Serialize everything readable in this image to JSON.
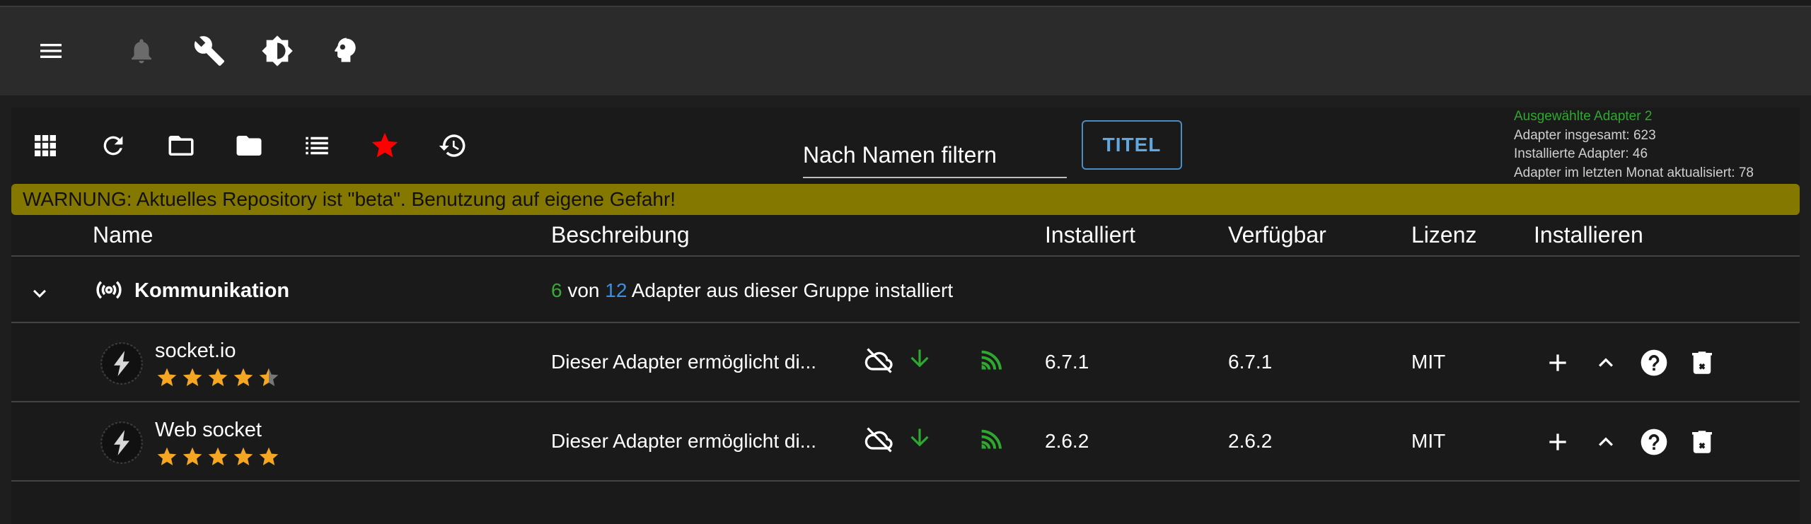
{
  "appbar": {
    "icons": [
      "menu-icon",
      "bell-icon",
      "wrench-icon",
      "brightness-icon",
      "expert-mode-icon"
    ]
  },
  "toolbar": {
    "icons": [
      "grid-view-icon",
      "refresh-icon",
      "folder-outline-icon",
      "folder-icon",
      "list-icon",
      "star-icon",
      "update-history-icon"
    ],
    "filter_placeholder": "Nach Namen filtern",
    "titel_label": "TITEL"
  },
  "stats": {
    "selected": "Ausgewählte Adapter 2",
    "total": "Adapter insgesamt: 623",
    "installed": "Installierte Adapter: 46",
    "updated": "Adapter im letzten Monat aktualisiert: 78"
  },
  "warning": "WARNUNG: Aktuelles Repository ist \"beta\". Benutzung auf eigene Gefahr!",
  "table": {
    "headers": {
      "name": "Name",
      "description": "Beschreibung",
      "installed": "Installiert",
      "available": "Verfügbar",
      "license": "Lizenz",
      "install": "Installieren"
    }
  },
  "group": {
    "name": "Kommunikation",
    "installed_count": "6",
    "von": "von",
    "total_count": "12",
    "suffix": "Adapter aus dieser Gruppe installiert"
  },
  "adapters": [
    {
      "name": "socket.io",
      "rating": 4.5,
      "description": "Dieser Adapter ermöglicht di...",
      "installed": "6.7.1",
      "available": "6.7.1",
      "license": "MIT"
    },
    {
      "name": "Web socket",
      "rating": 5,
      "description": "Dieser Adapter ermöglicht di...",
      "installed": "2.6.2",
      "available": "2.6.2",
      "license": "MIT"
    }
  ],
  "colors": {
    "warning_bg": "#857800",
    "star": "#f5a623",
    "accent_blue": "#4a8dc2",
    "green": "#2ea82e",
    "favorite_red": "#ff0000"
  }
}
